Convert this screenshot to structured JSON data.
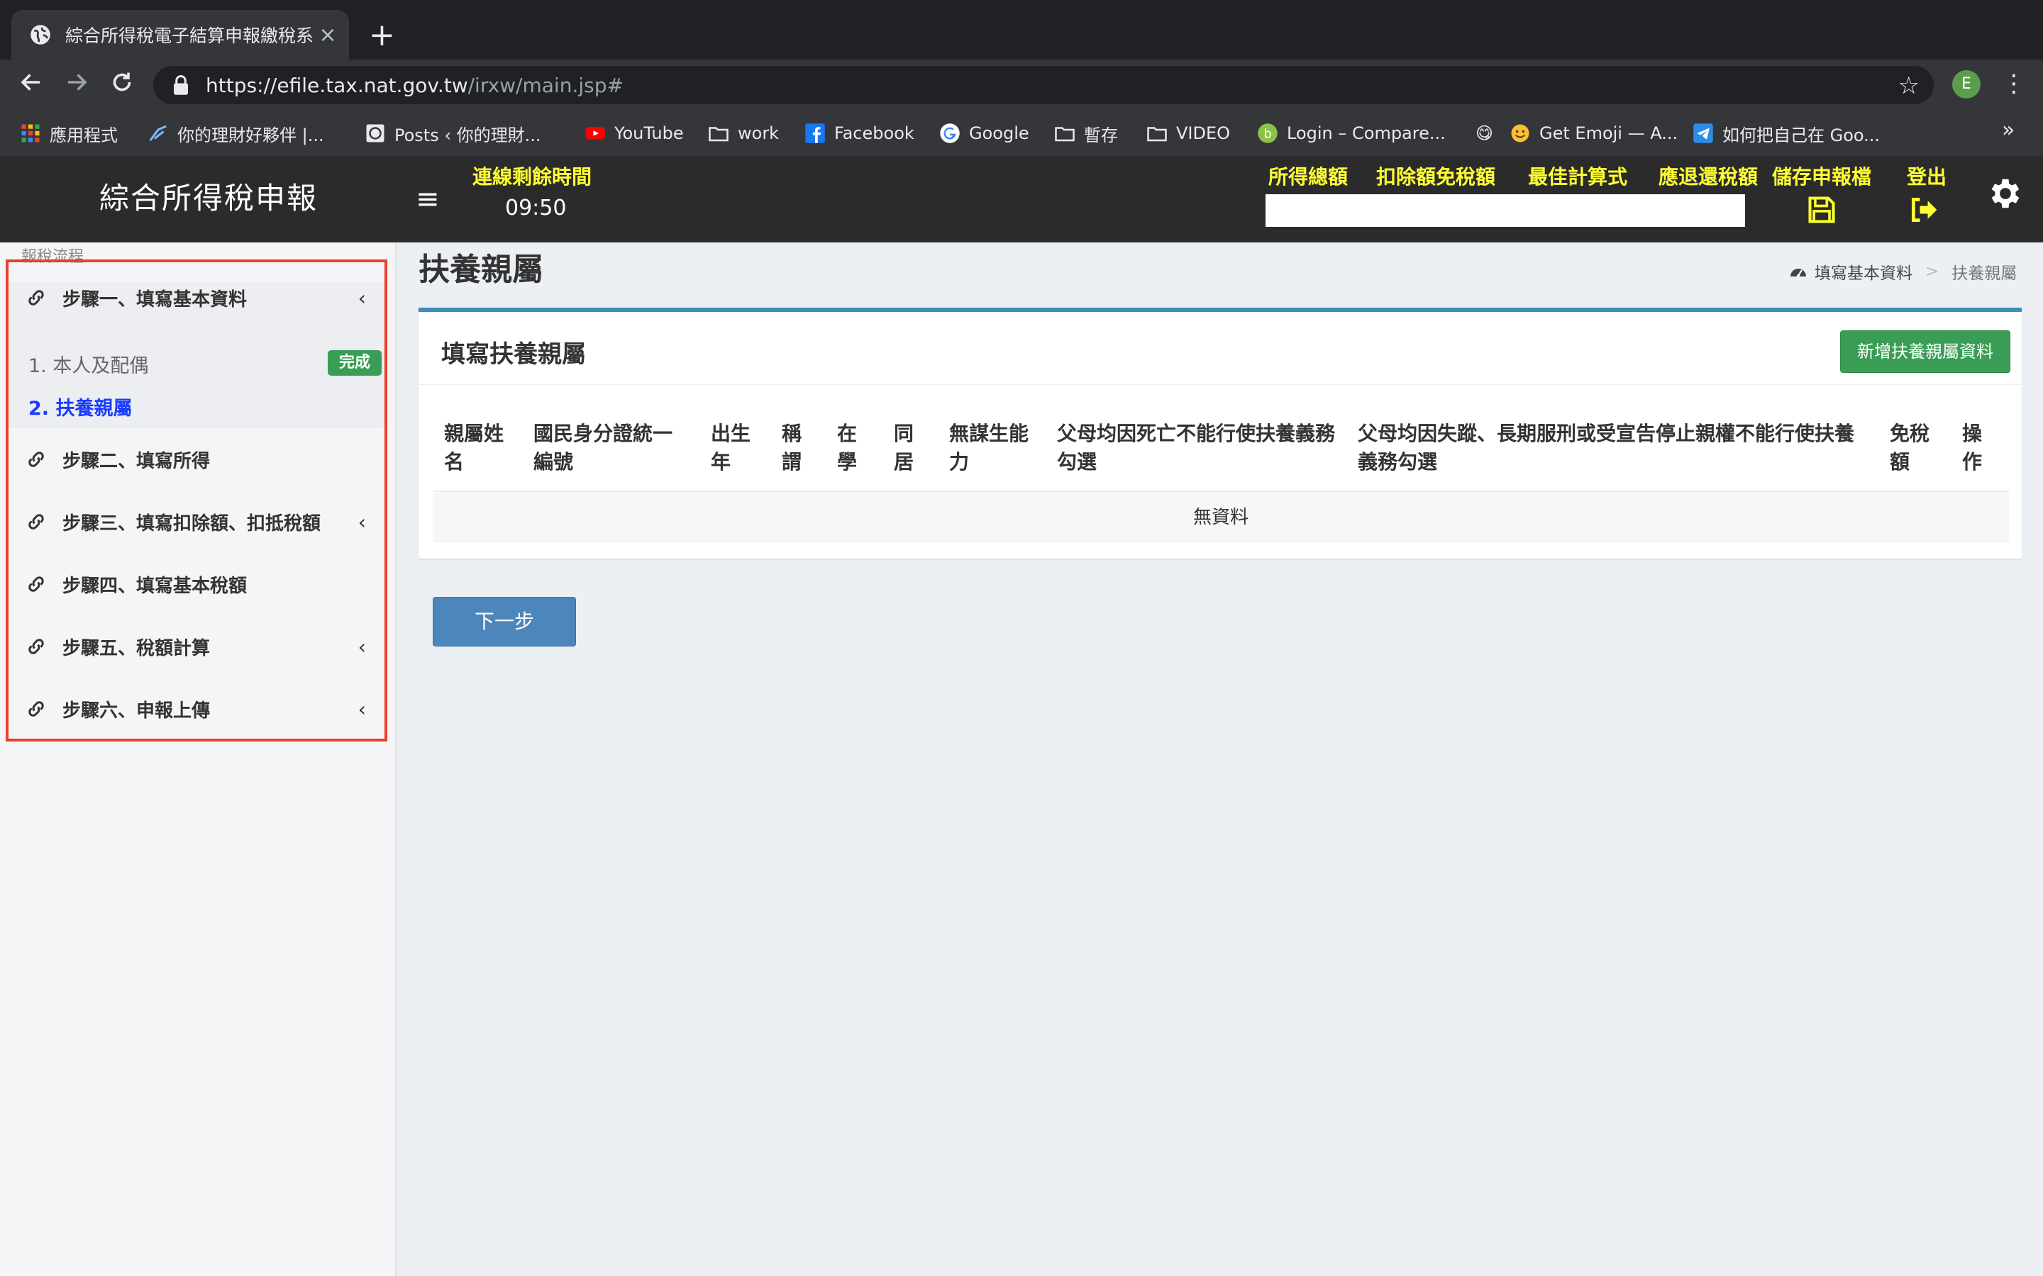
{
  "browser": {
    "tab_title": "綜合所得稅電子結算申報繳稅系統",
    "tab_close": "×",
    "new_tab": "+",
    "url_host": "https://efile.tax.nat.gov.tw",
    "url_path": "/irxw/main.jsp#",
    "profile_initial": "E",
    "bookmarks": [
      {
        "label": "應用程式",
        "icon": "apps-grid-icon"
      },
      {
        "label": "你的理財好夥伴 |...",
        "icon": "finance-icon"
      },
      {
        "label": "Posts ‹ 你的理財...",
        "icon": "wordpress-icon"
      },
      {
        "label": "YouTube",
        "icon": "youtube-icon"
      },
      {
        "label": "work",
        "icon": "folder-icon"
      },
      {
        "label": "Facebook",
        "icon": "facebook-icon"
      },
      {
        "label": "Google",
        "icon": "google-icon"
      },
      {
        "label": "暫存",
        "icon": "folder-icon"
      },
      {
        "label": "VIDEO",
        "icon": "folder-icon"
      },
      {
        "label": "Login – Compare...",
        "icon": "compare-icon"
      },
      {
        "label": "😋",
        "icon": "emoji-icon"
      },
      {
        "label": "Get Emoji — A...",
        "icon": "emoji-icon"
      },
      {
        "label": "如何把自己在 Goo...",
        "icon": "telegram-icon"
      }
    ],
    "bookmarks_more": "»"
  },
  "header": {
    "app_title": "綜合所得稅申報",
    "timer_label": "連線剩餘時間",
    "timer_value": "09:50",
    "links": {
      "income_total": "所得總額",
      "deductions": "扣除額免稅額",
      "best_formula": "最佳計算式",
      "refund": "應退還稅額",
      "save": "儲存申報檔",
      "logout": "登出"
    },
    "colors": {
      "bar": "#2b2b2b",
      "accent": "#ffff33"
    }
  },
  "sidebar": {
    "caption": "報稅流程",
    "steps": [
      {
        "label": "步驟一、填寫基本資料",
        "chevron": "‹"
      },
      {
        "label": "步驟二、填寫所得"
      },
      {
        "label": "步驟三、填寫扣除額、扣抵稅額",
        "chevron": "‹"
      },
      {
        "label": "步驟四、填寫基本稅額"
      },
      {
        "label": "步驟五、稅額計算",
        "chevron": "‹"
      },
      {
        "label": "步驟六、申報上傳",
        "chevron": "‹"
      }
    ],
    "substeps": [
      {
        "label": "1. 本人及配偶",
        "badge": "完成"
      },
      {
        "label": "2. 扶養親屬"
      }
    ]
  },
  "main": {
    "page_title": "扶養親屬",
    "breadcrumb": {
      "home": "填寫基本資料",
      "separator": ">",
      "current": "扶養親屬"
    },
    "box_title": "填寫扶養親屬",
    "add_button": "新增扶養親屬資料",
    "table": {
      "headers": [
        [
          "親屬姓",
          "名"
        ],
        [
          "國民身分證統一",
          "編號"
        ],
        [
          "出生",
          "年"
        ],
        [
          "稱",
          "謂"
        ],
        [
          "在",
          "學"
        ],
        [
          "同",
          "居"
        ],
        [
          "無謀生能",
          "力"
        ],
        [
          "父母均因死亡不能行使扶養義務",
          "勾選"
        ],
        [
          "父母均因失蹤、長期服刑或受宣告停止親權不能行使扶養",
          "義務勾選"
        ],
        [
          "免稅",
          "額"
        ],
        [
          "操",
          "作"
        ]
      ],
      "empty_text": "無資料"
    },
    "next_button": "下一步"
  }
}
